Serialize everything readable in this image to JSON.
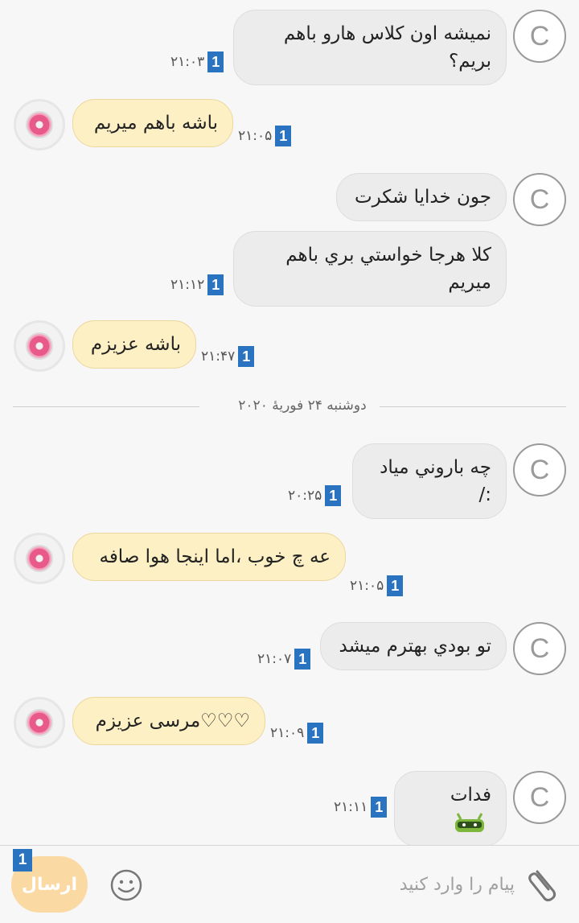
{
  "messages": [
    {
      "text": "نمیشه اون کلاس هارو باهم بریم؟",
      "time": "۲۱:۰۳",
      "count": "1"
    },
    {
      "text": "باشه باهم میریم",
      "time": "۲۱:۰۵",
      "count": "1"
    },
    {
      "text": "جون خدایا شکرت",
      "time": "",
      "count": ""
    },
    {
      "text": "کلا هرجا خواستي بري باهم میریم",
      "time": "۲۱:۱۲",
      "count": "1"
    },
    {
      "text": "باشه عزیزم",
      "time": "۲۱:۴۷",
      "count": "1"
    },
    {
      "text": "چه باروني مياد :/",
      "time": "۲۰:۲۵",
      "count": "1"
    },
    {
      "text": "عه چ خوب ،اما اینجا هوا صافه",
      "time": "۲۱:۰۵",
      "count": "1"
    },
    {
      "text": "تو بودي بهترم میشد",
      "time": "۲۱:۰۷",
      "count": "1"
    },
    {
      "text": "♡♡♡مرسی عزیزم",
      "time": "۲۱:۰۹",
      "count": "1"
    },
    {
      "text": "فدات",
      "time": "۲۱:۱۱",
      "count": "1"
    }
  ],
  "avatar_letter": "C",
  "date_divider": "دوشنبه ۲۴ فوریهٔ ۲۰۲۰",
  "input": {
    "placeholder": "پیام را وارد کنید",
    "send_label": "ارسال",
    "send_badge": "1"
  },
  "colors": {
    "incoming_bubble": "#ececec",
    "outgoing_bubble": "#fdf0c4",
    "badge": "#2a73c0",
    "send_button": "#fbd9a3"
  },
  "icons": {
    "avatar_other": "letter-c-avatar",
    "avatar_self": "donut-avatar",
    "emoji": "smiley-icon",
    "attach": "paperclip-icon",
    "sticker": "robot-sticker-icon"
  }
}
